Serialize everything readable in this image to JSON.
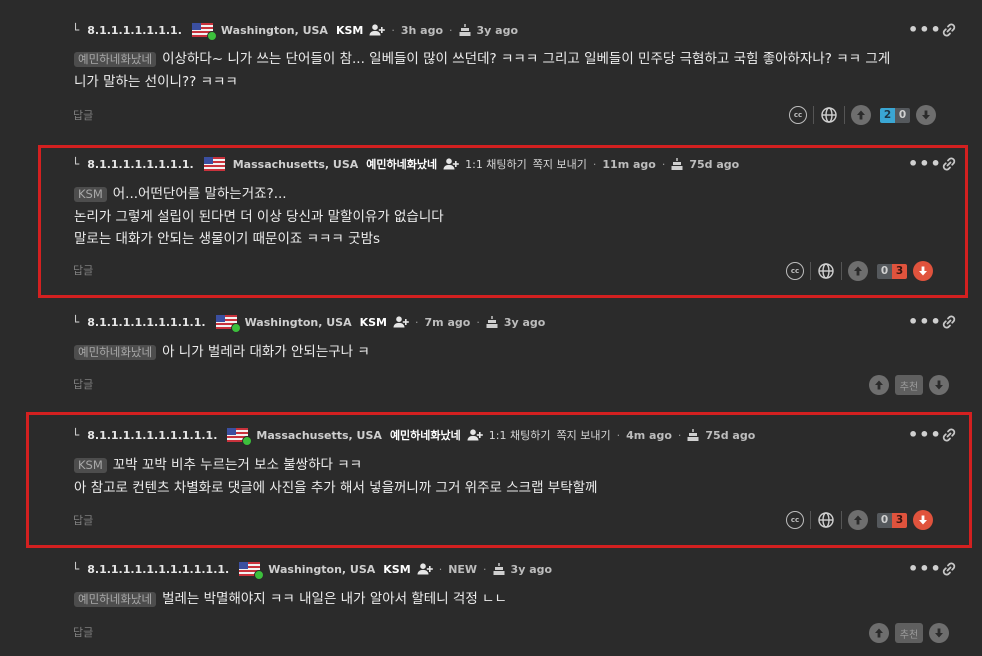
{
  "colors": {
    "background": "#2b2b2b",
    "highlight": "#d32020",
    "upvote_count": "#3aa6d3",
    "downvote": "#e0533d",
    "online": "#3cbf3c"
  },
  "comments": [
    {
      "depth_label": "8.1.1.1.1.1.1.1.",
      "location": "Washington, USA",
      "nickname": "KSM",
      "time": "3h ago",
      "account_age": "3y ago",
      "reply_to": "예민하네화났네",
      "lines": [
        "이상하다~ 니가 쓰는 단어들이 참... 일베들이 많이 쓰던데? ㅋㅋㅋ 그리고 일베들이 민주당 극혐하고 국힘 좋아하자나? ㅋㅋ 그게",
        "니가 말하는 선이니?? ㅋㅋㅋ"
      ],
      "reply_label": "답글",
      "upvotes": "2",
      "downvotes": "0",
      "icons": [
        "person-add-icon",
        "cake-icon",
        "more-icon",
        "link-icon",
        "cc-icon",
        "globe-icon",
        "upvote-icon",
        "downvote-icon"
      ]
    },
    {
      "depth_label": "8.1.1.1.1.1.1.1.1.",
      "location": "Massachusetts, USA",
      "nickname": "예민하네화났네",
      "chat_label": "1:1 채팅하기",
      "note_label": "쪽지 보내기",
      "time": "11m ago",
      "account_age": "75d ago",
      "reply_to": "KSM",
      "lines": [
        "어...어떤단어를 말하는거죠?...",
        "논리가 그렇게 설립이 된다면 더 이상 당신과 말할이유가 없습니다",
        "말로는 대화가 안되는 생물이기 때문이죠 ㅋㅋㅋ 굿밤s"
      ],
      "reply_label": "답글",
      "upvotes": "0",
      "downvotes": "3"
    },
    {
      "depth_label": "8.1.1.1.1.1.1.1.1.1.",
      "location": "Washington, USA",
      "nickname": "KSM",
      "time": "7m ago",
      "account_age": "3y ago",
      "reply_to": "예민하네화났네",
      "lines": [
        "아 니가 벌레라 대화가 안되는구나 ㅋ"
      ],
      "reply_label": "답글",
      "recommend_label": "추천"
    },
    {
      "depth_label": "8.1.1.1.1.1.1.1.1.1.1.",
      "location": "Massachusetts, USA",
      "nickname": "예민하네화났네",
      "chat_label": "1:1 채팅하기",
      "note_label": "쪽지 보내기",
      "time": "4m ago",
      "account_age": "75d ago",
      "reply_to": "KSM",
      "lines": [
        "꼬박 꼬박 비추 누르는거 보소 불쌍하다 ㅋㅋ",
        "아 참고로 컨텐츠 차별화로 댓글에 사진을 추가 해서 넣을꺼니까 그거 위주로 스크랩 부탁할께"
      ],
      "reply_label": "답글",
      "upvotes": "0",
      "downvotes": "3"
    },
    {
      "depth_label": "8.1.1.1.1.1.1.1.1.1.1.1.",
      "location": "Washington, USA",
      "nickname": "KSM",
      "time": "NEW",
      "account_age": "3y ago",
      "reply_to": "예민하네화났네",
      "lines": [
        "벌레는 박멸해야지 ㅋㅋ 내일은 내가 알아서 할테니 걱정 ㄴㄴ"
      ],
      "reply_label": "답글",
      "recommend_label": "추천"
    }
  ]
}
